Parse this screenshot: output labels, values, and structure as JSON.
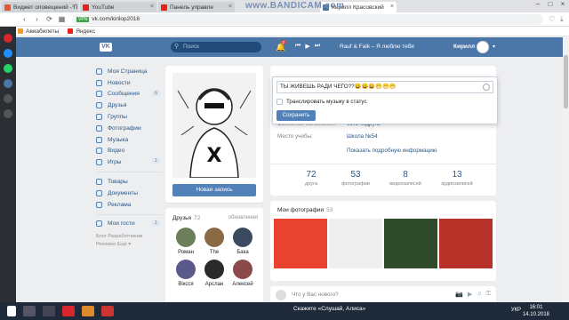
{
  "browser": {
    "tabs": [
      {
        "title": "Виджет оповещений - П",
        "color": "#e4572e"
      },
      {
        "title": "YouTube",
        "color": "#e62117"
      },
      {
        "title": "Панель управле",
        "color": "#e62117"
      },
      {
        "title": "Кирилл Красовский",
        "color": "#4a76a8"
      }
    ],
    "watermark": "www.BANDICAM.com",
    "url": "vk.com/kirilop2016",
    "vpn_label": "VPN",
    "bookmarks": [
      "Авиабилеты",
      "Яндекс"
    ]
  },
  "vk": {
    "logo": "VK",
    "search_placeholder": "Поиск",
    "notif_count": "2",
    "now_playing": "Rauf & Faik – Я люблю тебя",
    "user_name": "Кирилл",
    "menu": [
      {
        "label": "Моя Страница",
        "badge": ""
      },
      {
        "label": "Новости",
        "badge": ""
      },
      {
        "label": "Сообщения",
        "badge": "6"
      },
      {
        "label": "Друзья",
        "badge": ""
      },
      {
        "label": "Группы",
        "badge": ""
      },
      {
        "label": "Фотографии",
        "badge": ""
      },
      {
        "label": "Музыка",
        "badge": ""
      },
      {
        "label": "Видео",
        "badge": ""
      },
      {
        "label": "Игры",
        "badge": "1"
      }
    ],
    "menu2": [
      {
        "label": "Товары",
        "badge": ""
      },
      {
        "label": "Документы",
        "badge": ""
      },
      {
        "label": "Реклама",
        "badge": ""
      }
    ],
    "menu3": [
      {
        "label": "Мои гости",
        "badge": "1"
      }
    ],
    "footer_links": "Блог Разработчикам Реклама Ещё ▾",
    "new_post_button": "Новая запись",
    "friends": {
      "title": "Друзья",
      "count": "72",
      "updates": "обновления",
      "list": [
        "Роман",
        "The",
        "Бака",
        "Віксся",
        "Арслан",
        "Алексей"
      ]
    },
    "status_popup": {
      "text": "ТЫ ЖИВЕШЬ РАДИ ЧЕГО??😀😀😀😁😁😁",
      "broadcast_label": "Транслировать музыку в статус",
      "save_label": "Сохранить"
    },
    "info": [
      {
        "label": "Семейное положение:",
        "value": "есть подруга"
      },
      {
        "label": "Место учебы:",
        "value": "Школа №54"
      }
    ],
    "more_info": "Показать подробную информацию",
    "counters": [
      {
        "n": "72",
        "label": "друга"
      },
      {
        "n": "53",
        "label": "фотографии"
      },
      {
        "n": "8",
        "label": "видеозаписей"
      },
      {
        "n": "13",
        "label": "аудиозаписей"
      }
    ],
    "photos": {
      "title": "Мои фотографии",
      "count": "53"
    },
    "post_placeholder": "Что у Вас нового?"
  },
  "taskbar": {
    "music": "Скажите «Слушай, Алиса»",
    "lang": "УКР",
    "time": "16:01",
    "date": "14.10.2018"
  }
}
